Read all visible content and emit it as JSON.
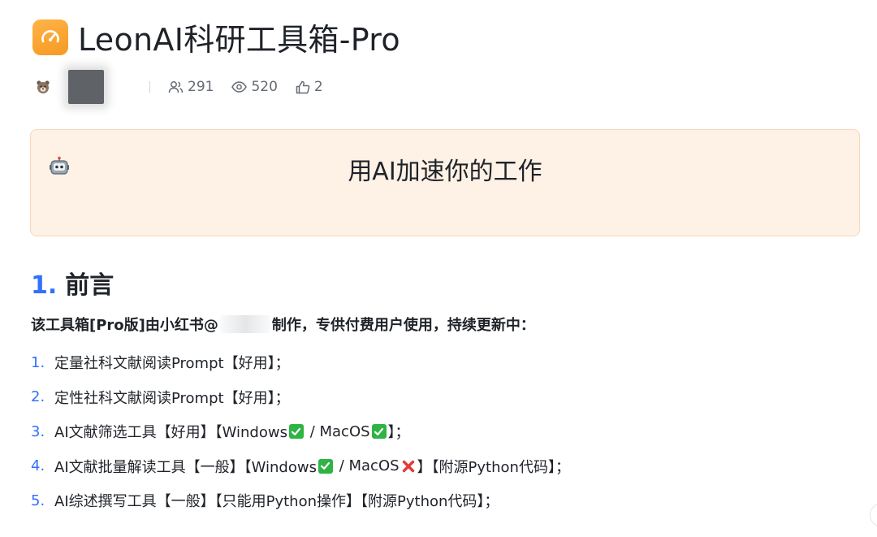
{
  "doc": {
    "title": "LeonAI科研工具箱-Pro",
    "icon": "speedometer-icon",
    "accent": "#f59a23"
  },
  "meta": {
    "avatar_icon": "bear-avatar-icon",
    "stats": {
      "readers": "291",
      "views": "520",
      "likes": "2"
    }
  },
  "callout": {
    "emoji": "robot-icon",
    "text": "用AI加速你的工作",
    "background": "#fef1e6",
    "border": "#f9d7b8"
  },
  "section": {
    "number": "1.",
    "title": "前言"
  },
  "intro": {
    "before": "该工具箱[Pro版]由小红书@",
    "after": "制作，专供付费用户使用，持续更新中："
  },
  "list": [
    {
      "num": "1.",
      "parts": [
        {
          "t": "text",
          "v": "定量社科文献阅读Prompt【好用】；"
        }
      ]
    },
    {
      "num": "2.",
      "parts": [
        {
          "t": "text",
          "v": "定性社科文献阅读Prompt【好用】；"
        }
      ]
    },
    {
      "num": "3.",
      "parts": [
        {
          "t": "text",
          "v": "AI文献筛选工具【好用】【Windows"
        },
        {
          "t": "check"
        },
        {
          "t": "text",
          "v": " / MacOS"
        },
        {
          "t": "check"
        },
        {
          "t": "text",
          "v": "】；"
        }
      ]
    },
    {
      "num": "4.",
      "parts": [
        {
          "t": "text",
          "v": "AI文献批量解读工具【一般】【Windows"
        },
        {
          "t": "check"
        },
        {
          "t": "text",
          "v": " / MacOS"
        },
        {
          "t": "cross"
        },
        {
          "t": "text",
          "v": "】【附源Python代码】；"
        }
      ]
    },
    {
      "num": "5.",
      "parts": [
        {
          "t": "text",
          "v": "AI综述撰写工具【一般】【只能用Python操作】【附源Python代码】；"
        }
      ]
    }
  ],
  "colors": {
    "link_blue": "#3370ff",
    "check_green": "#2fb344",
    "cross_red": "#e53935"
  }
}
